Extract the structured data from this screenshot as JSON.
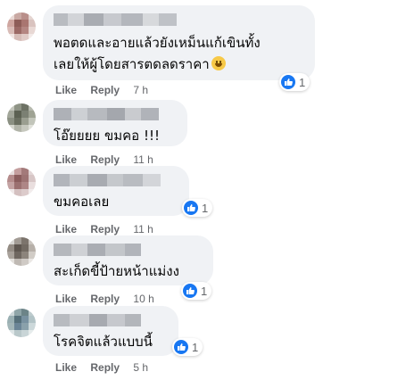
{
  "comments": [
    {
      "text": "พอตดและอายแล้วยังเหม็นแก้เขินทั้ง\nเลยให้ผู้โดยสารตดลดราคา",
      "emoji": "grinning-face-emoji",
      "actions": {
        "like": "Like",
        "reply": "Reply",
        "time": "7 h"
      },
      "reaction_count": "1"
    },
    {
      "text": "โอ๊ยยยย ขมคอ !!!",
      "actions": {
        "like": "Like",
        "reply": "Reply",
        "time": "11 h"
      }
    },
    {
      "text": "ขมคอเลย",
      "actions": {
        "like": "Like",
        "reply": "Reply",
        "time": "11 h"
      },
      "reaction_count": "1"
    },
    {
      "text": "สะเก็ดขี้ป้ายหน้าแม่งง",
      "actions": {
        "like": "Like",
        "reply": "Reply",
        "time": "10 h"
      },
      "reaction_count": "1"
    },
    {
      "text": "โรคจิตแล้วแบบนี้",
      "actions": {
        "like": "Like",
        "reply": "Reply",
        "time": "5 h"
      },
      "reaction_count": "1"
    }
  ],
  "colors": {
    "bubble": "#f0f2f5",
    "like_blue": "#1877f2",
    "meta_gray": "#65676b",
    "text": "#050505"
  },
  "icons": [
    "like-thumb-icon",
    "grinning-face-emoji"
  ]
}
